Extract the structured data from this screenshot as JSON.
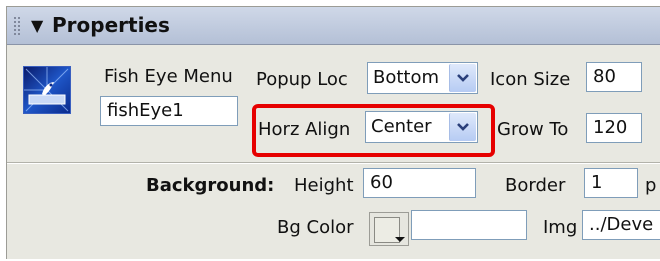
{
  "panel": {
    "title": "Properties"
  },
  "widget": {
    "type_label": "Fish Eye Menu",
    "id_value": "fishEye1"
  },
  "popup_loc": {
    "label": "Popup Loc",
    "value": "Bottom"
  },
  "icon_size": {
    "label": "Icon Size",
    "value": "80"
  },
  "horz_align": {
    "label": "Horz Align",
    "value": "Center"
  },
  "grow_to": {
    "label": "Grow To",
    "value": "120"
  },
  "background": {
    "section_label": "Background:",
    "height_label": "Height",
    "height_value": "60",
    "border_label": "Border",
    "border_value": "1",
    "border_unit": "p",
    "bgcolor_label": "Bg Color",
    "bgcolor_value": "",
    "img_label": "Img",
    "img_value": "../Deve"
  },
  "colors": {
    "highlight": "#e60000",
    "titlebar": "#c4cee0",
    "panel_bg": "#e8e8e1"
  }
}
